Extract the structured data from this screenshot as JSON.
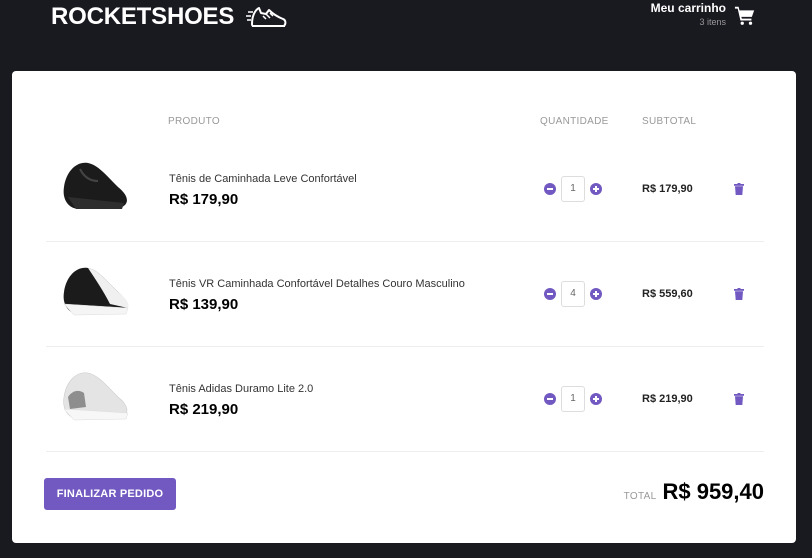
{
  "header": {
    "logo_text": "ROCKETSHOES",
    "cart_title": "Meu carrinho",
    "cart_count": "3 itens"
  },
  "table": {
    "col_product": "PRODUTO",
    "col_quantity": "QUANTIDADE",
    "col_subtotal": "SUBTOTAL"
  },
  "items": [
    {
      "title": "Tênis de Caminhada Leve Confortável",
      "price": "R$ 179,90",
      "quantity": "1",
      "subtotal": "R$ 179,90",
      "shoe_colors": [
        "#1a1a1a",
        "#333"
      ]
    },
    {
      "title": "Tênis VR Caminhada Confortável Detalhes Couro Masculino",
      "price": "R$ 139,90",
      "quantity": "4",
      "subtotal": "R$ 559,60",
      "shoe_colors": [
        "#1a1a1a",
        "#f2f2f2"
      ]
    },
    {
      "title": "Tênis Adidas Duramo Lite 2.0",
      "price": "R$ 219,90",
      "quantity": "1",
      "subtotal": "R$ 219,90",
      "shoe_colors": [
        "#e6e6e6",
        "#8f8f8f"
      ]
    }
  ],
  "footer": {
    "finish_label": "FINALIZAR PEDIDO",
    "total_label": "TOTAL",
    "total_value": "R$ 959,40"
  },
  "colors": {
    "background": "#191920",
    "accent": "#7159c1"
  }
}
